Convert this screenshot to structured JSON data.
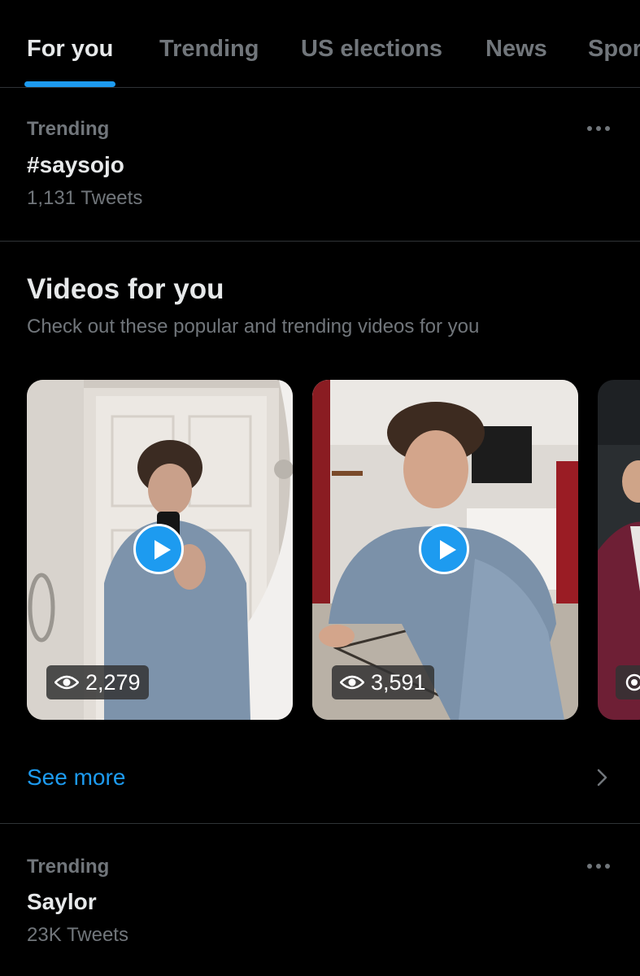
{
  "tabs": [
    {
      "label": "For you",
      "active": true
    },
    {
      "label": "Trending",
      "active": false
    },
    {
      "label": "US elections",
      "active": false
    },
    {
      "label": "News",
      "active": false
    },
    {
      "label": "Spor",
      "active": false
    }
  ],
  "trend_1": {
    "context": "Trending",
    "name": "#saysojo",
    "count": "1,131 Tweets"
  },
  "videos_module": {
    "title": "Videos for you",
    "subtitle": "Check out these popular and trending videos for you",
    "videos": [
      {
        "views": "2,279"
      },
      {
        "views": "3,591"
      }
    ],
    "see_more": "See more"
  },
  "trend_2": {
    "context": "Trending",
    "name": "Saylor",
    "count": "23K Tweets"
  },
  "colors": {
    "accent": "#1d9bf0",
    "background": "#000000",
    "secondary_text": "#71767b",
    "primary_text": "#e7e9ea",
    "divider": "#2f3336"
  },
  "icons": [
    "more-icon",
    "play-icon",
    "eye-icon",
    "chevron-right-icon"
  ]
}
